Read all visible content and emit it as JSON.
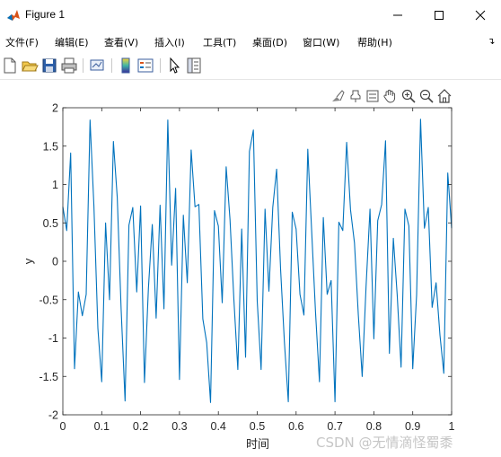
{
  "window": {
    "title": "Figure 1"
  },
  "menu": [
    {
      "label": "文件(F)"
    },
    {
      "label": "编辑(E)"
    },
    {
      "label": "查看(V)"
    },
    {
      "label": "插入(I)"
    },
    {
      "label": "工具(T)"
    },
    {
      "label": "桌面(D)"
    },
    {
      "label": "窗口(W)"
    },
    {
      "label": "帮助(H)"
    }
  ],
  "toolbar_icons": [
    "new-file-icon",
    "open-folder-icon",
    "save-icon",
    "print-icon",
    "link-plot-icon",
    "colorbar-icon",
    "legend-icon",
    "pointer-icon",
    "property-inspector-icon"
  ],
  "axes_toolbar_icons": [
    "brush-icon",
    "data-tip-icon",
    "rotate-icon",
    "pan-icon",
    "zoom-in-icon",
    "zoom-out-icon",
    "home-icon"
  ],
  "colors": {
    "line": "#0072BD",
    "axes": "#262626",
    "grid_bg": "#ffffff",
    "watermark": "#c6c6c6"
  },
  "watermark": "CSDN @无情滴怪蜀黍",
  "chart_data": {
    "type": "line",
    "xlabel": "时间",
    "ylabel": "y",
    "xlim": [
      0,
      1
    ],
    "ylim": [
      -2,
      2
    ],
    "xticks": [
      "0",
      "0.1",
      "0.2",
      "0.3",
      "0.4",
      "0.5",
      "0.6",
      "0.7",
      "0.8",
      "0.9",
      "1"
    ],
    "yticks": [
      "2",
      "1.5",
      "1",
      "0.5",
      "0",
      "-0.5",
      "-1",
      "-1.5",
      "-2"
    ],
    "grid": false,
    "series": [
      {
        "x": [
          0,
          0.01,
          0.02,
          0.03,
          0.04,
          0.05,
          0.06,
          0.07,
          0.08,
          0.09,
          0.1,
          0.11,
          0.12,
          0.13,
          0.14,
          0.15,
          0.16,
          0.17,
          0.18,
          0.19,
          0.2,
          0.21,
          0.22,
          0.23,
          0.24,
          0.25,
          0.26,
          0.27,
          0.28,
          0.29,
          0.3,
          0.31,
          0.32,
          0.33,
          0.34,
          0.35,
          0.36,
          0.37,
          0.38,
          0.39,
          0.4,
          0.41,
          0.42,
          0.43,
          0.44,
          0.45,
          0.46,
          0.47,
          0.48,
          0.49,
          0.5,
          0.51,
          0.52,
          0.53,
          0.54,
          0.55,
          0.56,
          0.57,
          0.58,
          0.59,
          0.6,
          0.61,
          0.62,
          0.63,
          0.64,
          0.65,
          0.66,
          0.67,
          0.68,
          0.69,
          0.7,
          0.71,
          0.72,
          0.73,
          0.74,
          0.75,
          0.76,
          0.77,
          0.78,
          0.79,
          0.8,
          0.81,
          0.82,
          0.83,
          0.84,
          0.85,
          0.86,
          0.87,
          0.88,
          0.89,
          0.9,
          0.91,
          0.92,
          0.93,
          0.94,
          0.95,
          0.96,
          0.97,
          0.98,
          0.99,
          1.0
        ],
        "values": [
          0.71,
          0.4,
          1.41,
          -1.4,
          -0.4,
          -0.71,
          -0.43,
          1.84,
          0.72,
          -0.87,
          -1.57,
          0.5,
          -0.5,
          1.56,
          0.83,
          -0.62,
          -1.82,
          0.47,
          0.7,
          -0.4,
          0.72,
          -1.58,
          -0.35,
          0.48,
          -0.74,
          0.73,
          -0.62,
          1.84,
          -0.05,
          0.95,
          -1.54,
          0.6,
          -0.28,
          1.45,
          0.71,
          0.74,
          -0.75,
          -1.06,
          -1.84,
          0.66,
          0.46,
          -0.54,
          1.23,
          0.54,
          -0.5,
          -1.41,
          0.42,
          -1.25,
          1.43,
          1.71,
          -0.52,
          -1.41,
          0.68,
          -0.39,
          0.7,
          1.2,
          -0.1,
          -1.06,
          -1.83,
          0.64,
          0.42,
          -0.43,
          -0.7,
          1.46,
          0.4,
          -0.66,
          -1.57,
          0.57,
          -0.43,
          -0.25,
          -1.83,
          0.51,
          0.4,
          1.55,
          0.67,
          0.24,
          -0.7,
          -1.5,
          -0.33,
          0.68,
          -1.01,
          0.53,
          0.74,
          1.57,
          -1.2,
          0.3,
          -0.44,
          -1.38,
          0.68,
          0.46,
          -1.4,
          -0.44,
          1.85,
          0.43,
          0.7,
          -0.6,
          -0.28,
          -0.96,
          -1.46,
          1.15,
          0.43
        ]
      }
    ]
  }
}
